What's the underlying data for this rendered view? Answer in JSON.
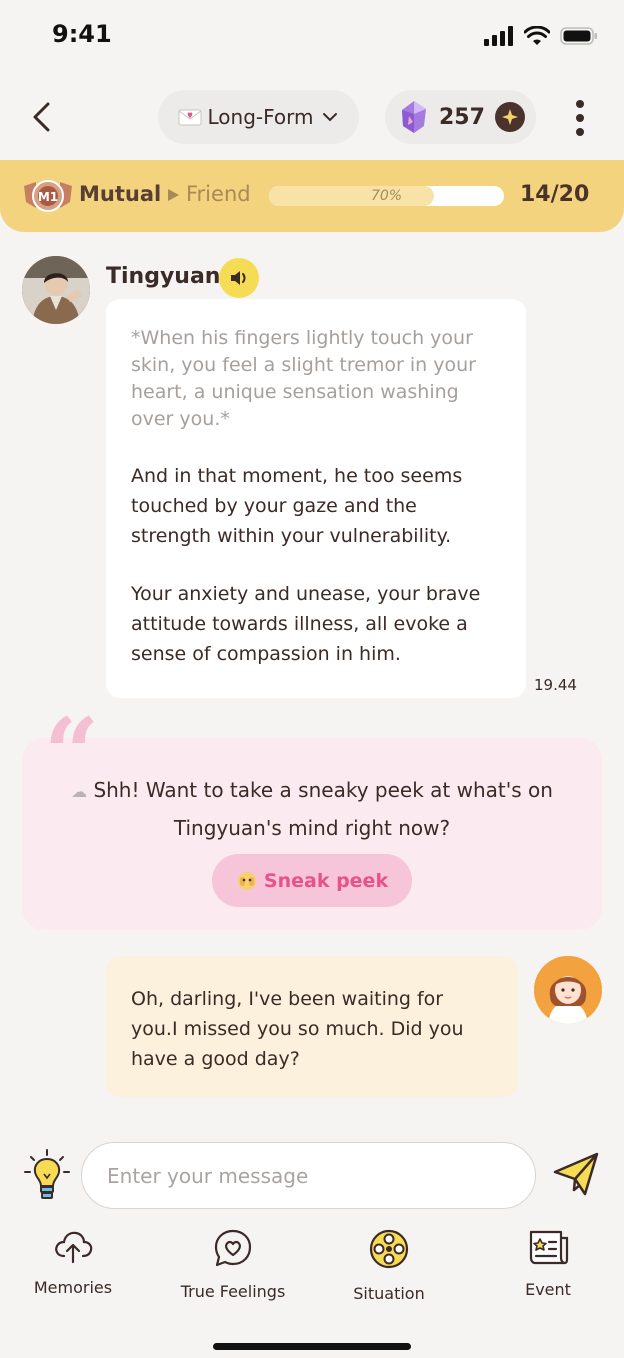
{
  "status_bar": {
    "time": "9:41"
  },
  "header": {
    "mode_label": "Long-Form",
    "gem_count": "257"
  },
  "relationship": {
    "current_level": "Mutual",
    "next_level": "Friend",
    "progress": 0.7,
    "progress_label": "70%",
    "count": "14/20"
  },
  "chat": {
    "bot": {
      "name": "Tingyuan",
      "narration": "*When his fingers lightly touch your skin, you feel a slight tremor in your heart, a unique sensation washing over you.*",
      "paragraph_1": "And in that moment, he too seems touched by your gaze and the strength within your vulnerability.",
      "paragraph_2": "Your anxiety and unease, your brave attitude towards illness, all evoke a sense of compassion in him.",
      "time": "19.44"
    },
    "peek": {
      "line_1": "Shh! Want to take a sneaky peek at what's on",
      "line_2": "Tingyuan's mind right now?",
      "button_label": "Sneak peek"
    },
    "user": {
      "message": "Oh, darling, I've been waiting for you.I missed you so much. Did you have a good day?"
    }
  },
  "composer": {
    "placeholder": "Enter your message",
    "value": ""
  },
  "nav": {
    "items": [
      {
        "label": "Memories",
        "icon": "cloud-upload-icon"
      },
      {
        "label": "True Feelings",
        "icon": "heart-bubble-icon"
      },
      {
        "label": "Situation",
        "icon": "film-reel-icon"
      },
      {
        "label": "Event",
        "icon": "star-card-icon"
      }
    ]
  },
  "colors": {
    "accent_yellow": "#f3d37d",
    "pink_card": "#fbebf1",
    "pink_button": "#f6c5d7",
    "pink_text": "#e8528a",
    "user_bubble": "#fcf1dc",
    "dark_brown": "#3b2a26"
  }
}
